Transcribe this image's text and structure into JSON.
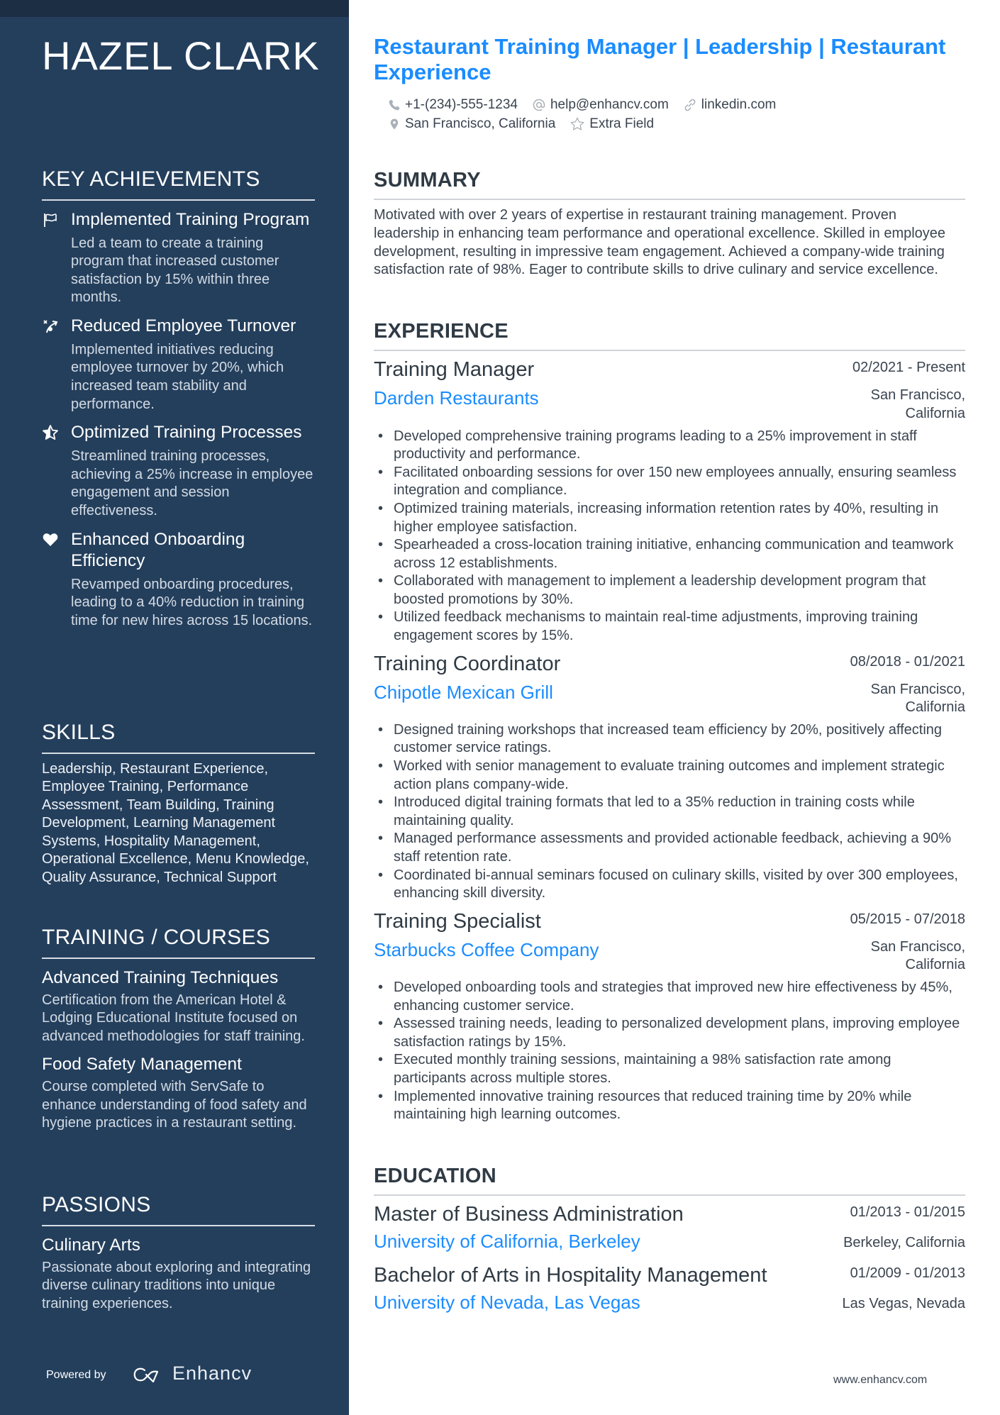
{
  "sidebar": {
    "name": "HAZEL CLARK",
    "achievements_heading": "KEY ACHIEVEMENTS",
    "achievements": [
      {
        "icon": "flag-icon",
        "title": "Implemented Training Program",
        "description": "Led a team to create a training program that increased customer satisfaction by 15% within three months."
      },
      {
        "icon": "trend-arrow-icon",
        "title": "Reduced Employee Turnover",
        "description": "Implemented initiatives reducing employee turnover by 20%, which increased team stability and performance."
      },
      {
        "icon": "star-half-icon",
        "title": "Optimized Training Processes",
        "description": "Streamlined training processes, achieving a 25% increase in employee engagement and session effectiveness."
      },
      {
        "icon": "heart-icon",
        "title": "Enhanced Onboarding Efficiency",
        "description": "Revamped onboarding procedures, leading to a 40% reduction in training time for new hires across 15 locations."
      }
    ],
    "skills_heading": "SKILLS",
    "skills_text": "Leadership, Restaurant Experience, Employee Training, Performance Assessment, Team Building, Training Development, Learning Management Systems, Hospitality Management, Operational Excellence, Menu Knowledge, Quality Assurance, Technical Support",
    "training_heading": "TRAINING / COURSES",
    "courses": [
      {
        "title": "Advanced Training Techniques",
        "description": "Certification from the American Hotel & Lodging Educational Institute focused on advanced methodologies for staff training."
      },
      {
        "title": "Food Safety Management",
        "description": "Course completed with ServSafe to enhance understanding of food safety and hygiene practices in a restaurant setting."
      }
    ],
    "passions_heading": "PASSIONS",
    "passions": [
      {
        "title": "Culinary Arts",
        "description": "Passionate about exploring and integrating diverse culinary traditions into unique training experiences."
      }
    ],
    "powered_by": "Powered by",
    "brand": "Enhancv"
  },
  "header": {
    "headline": "Restaurant Training Manager | Leadership | Restaurant Experience",
    "phone": "+1-(234)-555-1234",
    "email": "help@enhancv.com",
    "website": "linkedin.com",
    "location": "San Francisco, California",
    "extra": "Extra Field"
  },
  "summary": {
    "heading": "SUMMARY",
    "text": "Motivated with over 2 years of expertise in restaurant training management. Proven leadership in enhancing team performance and operational excellence. Skilled in employee development, resulting in impressive team engagement. Achieved a company-wide training satisfaction rate of 98%. Eager to contribute skills to drive culinary and service excellence."
  },
  "experience": {
    "heading": "EXPERIENCE",
    "jobs": [
      {
        "title": "Training Manager",
        "dates": "02/2021 - Present",
        "company": "Darden Restaurants",
        "location": "San Francisco, California",
        "bullets": [
          "Developed comprehensive training programs leading to a 25% improvement in staff productivity and performance.",
          "Facilitated onboarding sessions for over 150 new employees annually, ensuring seamless integration and compliance.",
          "Optimized training materials, increasing information retention rates by 40%, resulting in higher employee satisfaction.",
          "Spearheaded a cross-location training initiative, enhancing communication and teamwork across 12 establishments.",
          "Collaborated with management to implement a leadership development program that boosted promotions by 30%.",
          "Utilized feedback mechanisms to maintain real-time adjustments, improving training engagement scores by 15%."
        ]
      },
      {
        "title": "Training Coordinator",
        "dates": "08/2018 - 01/2021",
        "company": "Chipotle Mexican Grill",
        "location": "San Francisco, California",
        "bullets": [
          "Designed training workshops that increased team efficiency by 20%, positively affecting customer service ratings.",
          "Worked with senior management to evaluate training outcomes and implement strategic action plans company-wide.",
          "Introduced digital training formats that led to a 35% reduction in training costs while maintaining quality.",
          "Managed performance assessments and provided actionable feedback, achieving a 90% staff retention rate.",
          "Coordinated bi-annual seminars focused on culinary skills, visited by over 300 employees, enhancing skill diversity."
        ]
      },
      {
        "title": "Training Specialist",
        "dates": "05/2015 - 07/2018",
        "company": "Starbucks Coffee Company",
        "location": "San Francisco, California",
        "bullets": [
          "Developed onboarding tools and strategies that improved new hire effectiveness by 45%, enhancing customer service.",
          "Assessed training needs, leading to personalized development plans, improving employee satisfaction ratings by 15%.",
          "Executed monthly training sessions, maintaining a 98% satisfaction rate among participants across multiple stores.",
          "Implemented innovative training resources that reduced training time by 20% while maintaining high learning outcomes."
        ]
      }
    ]
  },
  "education": {
    "heading": "EDUCATION",
    "items": [
      {
        "degree": "Master of Business Administration",
        "dates": "01/2013 - 01/2015",
        "school": "University of California, Berkeley",
        "location": "Berkeley, California"
      },
      {
        "degree": "Bachelor of Arts in Hospitality Management",
        "dates": "01/2009 - 01/2013",
        "school": "University of Nevada, Las Vegas",
        "location": "Las Vegas, Nevada"
      }
    ]
  },
  "footer": {
    "url": "www.enhancv.com"
  },
  "colors": {
    "sidebar": "#243f5c",
    "sidebar_top": "#1b2e44",
    "accent": "#1a8cff",
    "text": "#2f3a44"
  }
}
